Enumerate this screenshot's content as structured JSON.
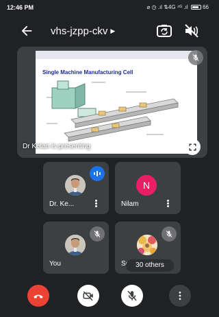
{
  "status_bar": {
    "time": "12:46 PM",
    "indicators": "⌀ ◷ .ıl ⇅4G ⁴ᴳ .ıl",
    "battery": "66"
  },
  "header": {
    "meeting_code": "vhs-jzpp-ckv",
    "icons": [
      "back-arrow-icon",
      "switch-camera-icon",
      "audio-off-icon"
    ]
  },
  "presentation": {
    "slide_title": "Single Machine Manufacturing Cell",
    "presenter_label": "Dr Ketan is presenting",
    "icons": [
      "mic-off-icon",
      "fullscreen-icon"
    ]
  },
  "participants": [
    {
      "name": "Dr. Ke...",
      "avatar": "photo",
      "status": "speaking"
    },
    {
      "name": "Nilam",
      "avatar": "N",
      "status": ""
    },
    {
      "name": "You",
      "avatar": "photo",
      "status": "muted"
    },
    {
      "name": "So...",
      "avatar": "group-photo",
      "status": "muted"
    }
  ],
  "others_count_label": "30 others",
  "controls": {
    "icons": [
      "end-call-icon",
      "video-off-icon",
      "mic-off-icon",
      "more-options-icon"
    ],
    "colors": {
      "end_call": "#ea4335",
      "speaking": "#1a73e8",
      "avatar_n": "#e91e63"
    }
  }
}
